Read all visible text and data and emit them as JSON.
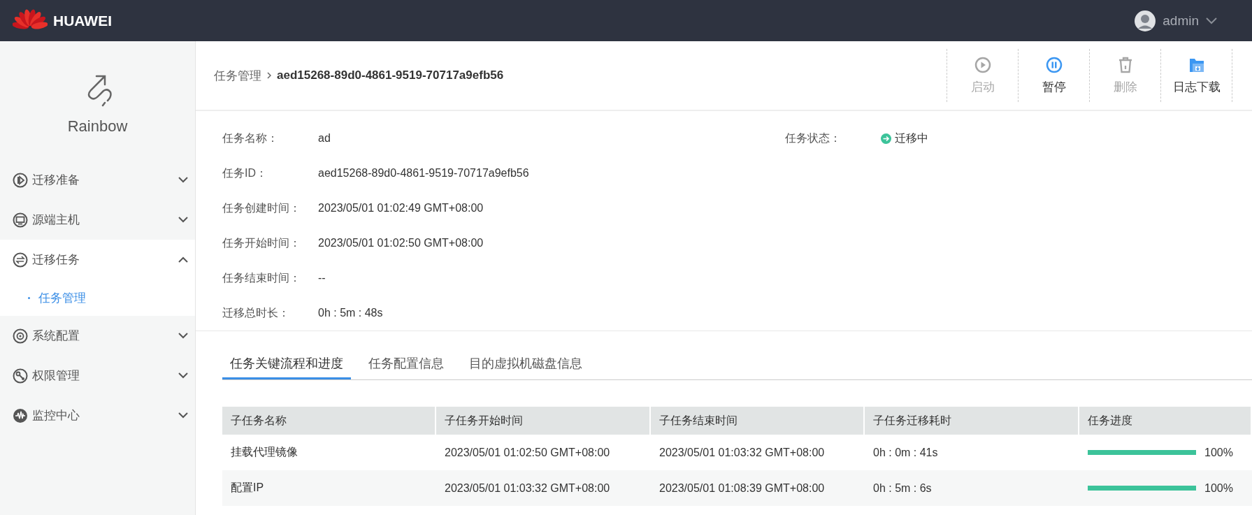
{
  "header": {
    "brand": "HUAWEI",
    "user": "admin"
  },
  "sidebar": {
    "app_name": "Rainbow",
    "items": [
      {
        "label": "迁移准备",
        "expanded": false
      },
      {
        "label": "源端主机",
        "expanded": false
      },
      {
        "label": "迁移任务",
        "expanded": true,
        "children": [
          {
            "label": "任务管理",
            "selected": true
          }
        ]
      },
      {
        "label": "系统配置",
        "expanded": false
      },
      {
        "label": "权限管理",
        "expanded": false
      },
      {
        "label": "监控中心",
        "expanded": false
      }
    ]
  },
  "breadcrumb": {
    "parent": "任务管理",
    "current": "aed15268-89d0-4861-9519-70717a9efb56"
  },
  "toolbar": [
    {
      "label": "启动",
      "disabled": true
    },
    {
      "label": "暂停",
      "disabled": false
    },
    {
      "label": "删除",
      "disabled": true
    },
    {
      "label": "日志下载",
      "disabled": false
    }
  ],
  "details": [
    {
      "label": "任务名称：",
      "value": "ad"
    },
    {
      "label": "任务ID：",
      "value": "aed15268-89d0-4861-9519-70717a9efb56"
    },
    {
      "label": "任务创建时间：",
      "value": "2023/05/01 01:02:49 GMT+08:00"
    },
    {
      "label": "任务开始时间：",
      "value": "2023/05/01 01:02:50 GMT+08:00"
    },
    {
      "label": "任务结束时间：",
      "value": "--"
    },
    {
      "label": "迁移总时长：",
      "value": "0h : 5m : 48s"
    }
  ],
  "status": {
    "label": "任务状态：",
    "value": "迁移中",
    "color": "#3cc39a"
  },
  "tabs": [
    {
      "label": "任务关键流程和进度",
      "selected": true
    },
    {
      "label": "任务配置信息",
      "selected": false
    },
    {
      "label": "目的虚拟机磁盘信息",
      "selected": false
    }
  ],
  "table": {
    "columns": [
      "子任务名称",
      "子任务开始时间",
      "子任务结束时间",
      "子任务迁移耗时",
      "任务进度"
    ],
    "rows": [
      {
        "cells": [
          "挂载代理镜像",
          "2023/05/01 01:02:50 GMT+08:00",
          "2023/05/01 01:03:32 GMT+08:00",
          "0h : 0m : 41s"
        ],
        "level": 1,
        "reading": "100%"
      },
      {
        "cells": [
          "配置IP",
          "2023/05/01 01:03:32 GMT+08:00",
          "2023/05/01 01:08:39 GMT+08:00",
          "0h : 5m : 6s"
        ],
        "level": 1,
        "reading": "100%"
      }
    ]
  }
}
